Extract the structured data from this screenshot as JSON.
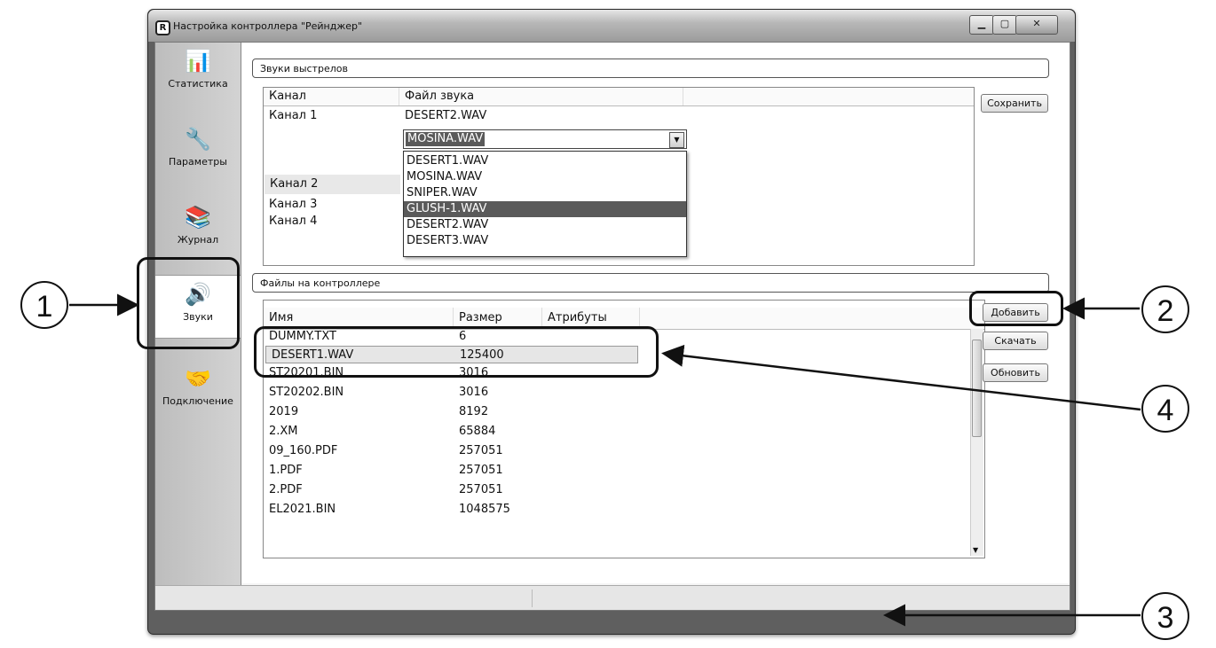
{
  "window": {
    "title": "Настройка контроллера \"Рейнджер\"",
    "app_icon_letter": "R"
  },
  "sidebar": {
    "items": [
      {
        "label": "Статистика",
        "icon": "chart-icon",
        "glyph": "📊"
      },
      {
        "label": "Параметры",
        "icon": "wrench-icon",
        "glyph": "🔧"
      },
      {
        "label": "Журнал",
        "icon": "journal-icon",
        "glyph": "📚"
      },
      {
        "label": "Звуки",
        "icon": "speaker-icon",
        "glyph": "🔊"
      },
      {
        "label": "Подключение",
        "icon": "handshake-icon",
        "glyph": "🤝"
      }
    ],
    "active": "Звуки"
  },
  "shots": {
    "title": "Звуки выстрелов",
    "columns": [
      "Канал",
      "Файл звука"
    ],
    "rows": [
      {
        "channel": "Канал 1",
        "file": "DESERT2.WAV"
      },
      {
        "channel": "Канал 2",
        "file": "MOSINA.WAV"
      },
      {
        "channel": "Канал 3",
        "file": ""
      },
      {
        "channel": "Канал 4",
        "file": ""
      }
    ],
    "save_label": "Сохранить",
    "combo_value": "MOSINA.WAV",
    "dropdown_options": [
      "DESERT1.WAV",
      "MOSINA.WAV",
      "SNIPER.WAV",
      "GLUSH-1.WAV",
      "DESERT2.WAV",
      "DESERT3.WAV"
    ],
    "dropdown_highlighted": "GLUSH-1.WAV"
  },
  "files": {
    "title": "Файлы на контроллере",
    "columns": [
      "Имя",
      "Размер",
      "Атрибуты"
    ],
    "rows": [
      {
        "name": "DUMMY.TXT",
        "size": "6"
      },
      {
        "name": "DESERT1.WAV",
        "size": "125400"
      },
      {
        "name": "ST20201.BIN",
        "size": "3016"
      },
      {
        "name": "ST20202.BIN",
        "size": "3016"
      },
      {
        "name": "2019",
        "size": "8192"
      },
      {
        "name": "2.XM",
        "size": "65884"
      },
      {
        "name": "09_160.PDF",
        "size": "257051"
      },
      {
        "name": "1.PDF",
        "size": "257051"
      },
      {
        "name": "2.PDF",
        "size": "257051"
      },
      {
        "name": "EL2021.BIN",
        "size": "1048575"
      }
    ],
    "selected": "DESERT1.WAV",
    "buttons": {
      "add": "Добавить",
      "download": "Скачать",
      "refresh": "Обновить"
    }
  },
  "callouts": {
    "c1": "1",
    "c2": "2",
    "c3": "3",
    "c4": "4"
  },
  "colors": {
    "selection": "#5a5a5a",
    "frame": "#5f5f5f"
  }
}
